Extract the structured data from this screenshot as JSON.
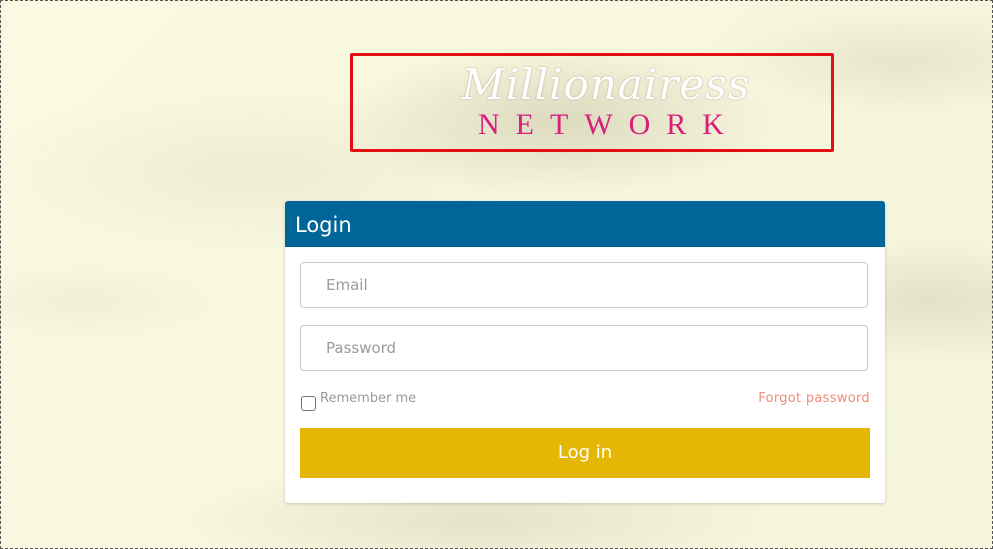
{
  "brand": {
    "script_text": "Millionairess",
    "word_text": "NETWORK",
    "script_color": "#ffffff",
    "word_color": "#d81f7b",
    "highlight_border_color": "#e21010"
  },
  "login": {
    "title": "Login",
    "header_color": "#006699",
    "email": {
      "placeholder": "Email",
      "value": ""
    },
    "password": {
      "placeholder": "Password",
      "value": ""
    },
    "remember_label": "Remember me",
    "remember_checked": false,
    "forgot_label": "Forgot password",
    "forgot_color": "#f08a78",
    "submit_label": "Log in",
    "submit_color": "#e4b707"
  }
}
